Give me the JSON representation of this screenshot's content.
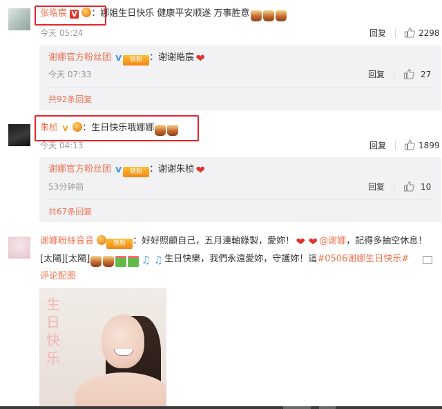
{
  "comment1": {
    "user": "张皓宸",
    "text": "：娜姐生日快乐 健康平安顺遂 万事胜意",
    "emojis": [
      "cake",
      "cake",
      "cake"
    ],
    "time": "今天 05:24",
    "reply_label": "回复",
    "likes": "2298",
    "sub_reply": {
      "user": "谢娜官方粉丝团",
      "badge": "铁粉",
      "text": "：谢谢皓宸",
      "emoji": "heart",
      "time": "今天 07:33",
      "reply_label": "回复",
      "likes": "27"
    },
    "more_replies": "共92条回复"
  },
  "comment2": {
    "user": "朱桢",
    "text": "：生日快乐哦娜娜",
    "emojis": [
      "cake",
      "cake"
    ],
    "time": "今天 04:13",
    "reply_label": "回复",
    "likes": "1899",
    "sub_reply": {
      "user": "谢娜官方粉丝团",
      "badge": "铁粉",
      "text": "：谢谢朱桢",
      "emoji": "heart",
      "time": "53分钟前",
      "reply_label": "回复",
      "likes": "10"
    },
    "more_replies": "共67条回复"
  },
  "comment3": {
    "user": "谢娜粉絲音音",
    "badge": "铁粉",
    "line1_text": "：好好照顧自己，五月連軸錄製，愛妳！",
    "mention": "@谢娜",
    "line1_tail": "，記得多抽空休息！",
    "line2_lead": "[太陽][太陽]",
    "line2_text": "生日快樂，我們永遠愛妳，守護妳！這",
    "hashtag": "#0506谢娜生日快乐#",
    "pic_link": "评论配图",
    "photo_caption": "生日快乐"
  },
  "colors": {
    "accent": "#eb7350",
    "highlight_box": "#e0242b",
    "reply_bg": "#f2f2f5",
    "verified_gold": "#f1a21a",
    "verified_blue": "#2a8cdb"
  }
}
